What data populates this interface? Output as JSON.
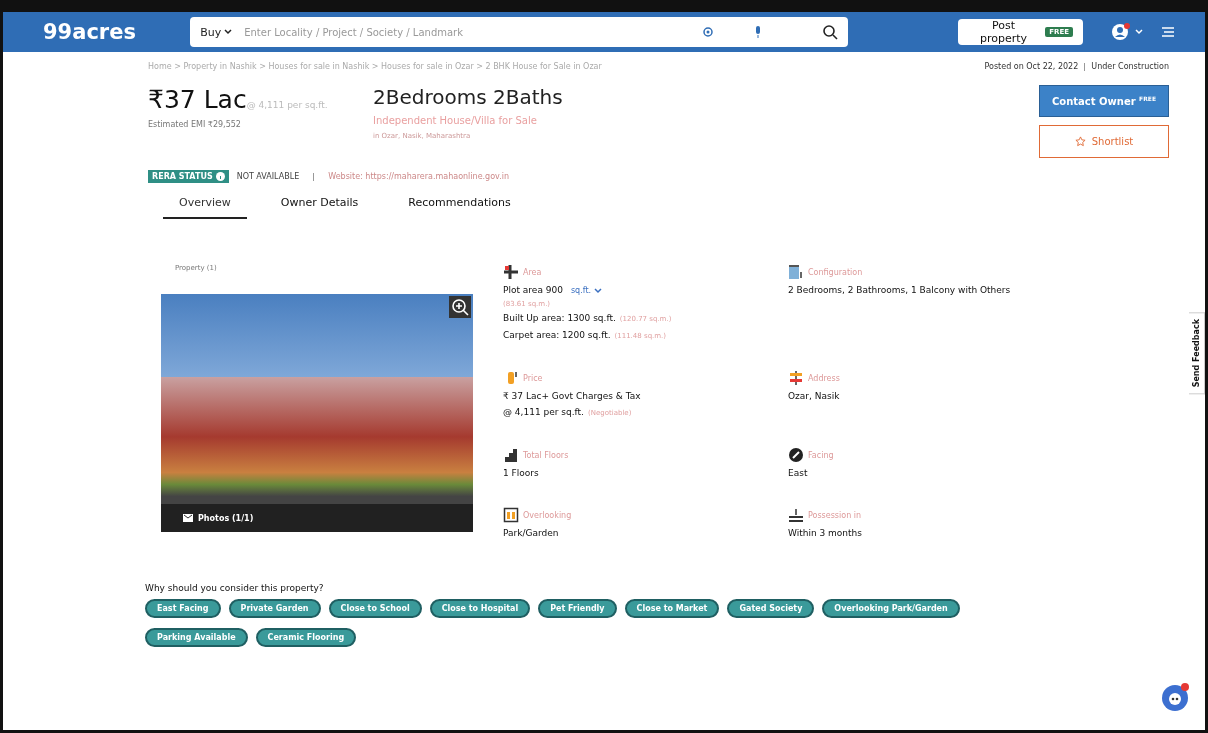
{
  "header": {
    "logo": "99acres",
    "search": {
      "category": "Buy",
      "placeholder": "Enter Locality / Project / Society / Landmark"
    },
    "post_property": {
      "label": "Post property",
      "badge": "FREE"
    }
  },
  "breadcrumb": "Home > Property in Nashik > Houses for sale in Nashik > Houses for sale in Ozar > 2 BHK House for Sale in Ozar",
  "posted": "Posted on Oct 22, 2022",
  "status": "Under Construction",
  "price": {
    "amount": "₹37 Lac",
    "rate": "@ 4,111 per sq.ft.",
    "emi": "Estimated EMI ₹29,552"
  },
  "listing": {
    "title": "2Bedrooms 2Baths",
    "type": "Independent House/Villa for Sale",
    "location": "in Ozar, Nasik, Maharashtra"
  },
  "actions": {
    "contact": {
      "label": "Contact Owner",
      "badge": "FREE"
    },
    "shortlist": {
      "label": "Shortlist"
    }
  },
  "rera": {
    "badge": "RERA STATUS",
    "status": "NOT AVAILABLE",
    "website": "Website: https://maharera.mahaonline.gov.in"
  },
  "tabs": [
    {
      "label": "Overview",
      "selected": true
    },
    {
      "label": "Owner Details",
      "selected": false
    },
    {
      "label": "Recommendations",
      "selected": false
    }
  ],
  "gallery": {
    "label": "Property (1)",
    "photos": "Photos (1/1)"
  },
  "details": [
    {
      "kind": "area",
      "label": "Area",
      "lines": [
        {
          "text": "Plot area 900",
          "unit": "sq.ft."
        },
        {
          "note": "(83.61 sq.m.)"
        },
        {
          "text": "Built Up area: 1300 sq.ft.",
          "note": "(120.77 sq.m.)"
        },
        {
          "text": "Carpet area: 1200 sq.ft.",
          "note": "(111.48 sq.m.)"
        }
      ]
    },
    {
      "kind": "configuration",
      "label": "Configuration",
      "lines": [
        {
          "text": "2 Bedrooms, 2 Bathrooms, 1 Balcony with Others"
        }
      ]
    },
    {
      "kind": "price",
      "label": "Price",
      "lines": [
        {
          "text": "₹ 37 Lac+ Govt Charges & Tax"
        },
        {
          "text": "@ 4,111 per sq.ft.",
          "note": "(Negotiable)"
        }
      ]
    },
    {
      "kind": "address",
      "label": "Address",
      "lines": [
        {
          "text": "Ozar, Nasik"
        }
      ]
    },
    {
      "kind": "floors",
      "label": "Total Floors",
      "lines": [
        {
          "text": "1 Floors"
        }
      ]
    },
    {
      "kind": "facing",
      "label": "Facing",
      "lines": [
        {
          "text": "East"
        }
      ]
    },
    {
      "kind": "overlooking",
      "label": "Overlooking",
      "lines": [
        {
          "text": "Park/Garden"
        }
      ]
    },
    {
      "kind": "possession",
      "label": "Possession in",
      "lines": [
        {
          "text": "Within 3 months"
        }
      ]
    }
  ],
  "why": {
    "title": "Why should you consider this property?",
    "chips": [
      "East Facing",
      "Private Garden",
      "Close to School",
      "Close to Hospital",
      "Pet Friendly",
      "Close to Market",
      "Gated Society",
      "Overlooking Park/Garden",
      "Parking Available",
      "Ceramic Flooring"
    ]
  },
  "feedback": "Send Feedback"
}
